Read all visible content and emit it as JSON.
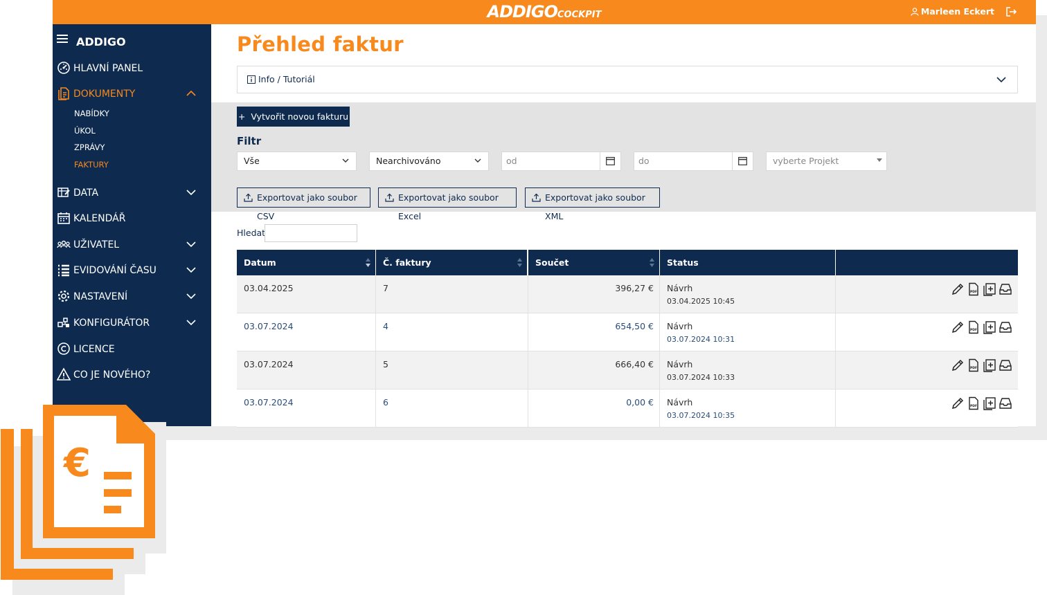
{
  "app": {
    "brand_main": "ADDIGO",
    "brand_sub": "COCKPIT",
    "user_name": "Marleen Eckert"
  },
  "sidebar": {
    "title": "ADDIGO",
    "items": [
      {
        "label": "HLAVNÍ PANEL",
        "icon": "dashboard-icon"
      },
      {
        "label": "DOKUMENTY",
        "icon": "document-icon",
        "active": true,
        "expanded": true
      },
      {
        "label": "DATA",
        "icon": "data-icon"
      },
      {
        "label": "KALENDÁŘ",
        "icon": "calendar-icon"
      },
      {
        "label": "UŽIVATEL",
        "icon": "users-icon"
      },
      {
        "label": "EVIDOVÁNÍ ČASU",
        "icon": "list-icon"
      },
      {
        "label": "NASTAVENÍ",
        "icon": "gear-icon"
      },
      {
        "label": "KONFIGURÁTOR",
        "icon": "configurator-icon"
      },
      {
        "label": "LICENCE",
        "icon": "copyright-icon"
      },
      {
        "label": "CO JE NOVÉHO?",
        "icon": "warning-icon"
      }
    ],
    "sub_items": [
      "NABÍDKY",
      "ÚKOL",
      "ZPRÁVY",
      "FAKTURY"
    ]
  },
  "page": {
    "title": "Přehled faktur",
    "info_label": "Info / Tutoriál",
    "new_button": "Vytvořit novou fakturu",
    "filter_title": "Filtr",
    "filter_type_value": "Vše",
    "filter_archive_value": "Nearchivováno",
    "date_from_placeholder": "od",
    "date_to_placeholder": "do",
    "project_placeholder": "vyberte Projekt",
    "export_csv": "Exportovat jako soubor CSV",
    "export_excel": "Exportovat jako soubor Excel",
    "export_xml": "Exportovat jako soubor XML",
    "search_label": "Hledat:"
  },
  "table": {
    "columns": [
      "Datum",
      "Č. faktury",
      "Součet",
      "Status",
      ""
    ],
    "rows": [
      {
        "date": "03.04.2025",
        "number": "7",
        "sum": "396,27 €",
        "status": "Návrh",
        "timestamp": "03.04.2025 10:45"
      },
      {
        "date": "03.07.2024",
        "number": "4",
        "sum": "654,50 €",
        "status": "Návrh",
        "timestamp": "03.07.2024 10:31"
      },
      {
        "date": "03.07.2024",
        "number": "5",
        "sum": "666,40 €",
        "status": "Návrh",
        "timestamp": "03.07.2024 10:33"
      },
      {
        "date": "03.07.2024",
        "number": "6",
        "sum": "0,00 €",
        "status": "Návrh",
        "timestamp": "03.07.2024 10:35"
      }
    ],
    "row_actions": [
      "edit-icon",
      "pdf-icon",
      "duplicate-icon",
      "archive-icon"
    ]
  },
  "colors": {
    "accent": "#f7891d",
    "navy": "#0e2b4f",
    "panel_gray": "#e3e3e3"
  }
}
